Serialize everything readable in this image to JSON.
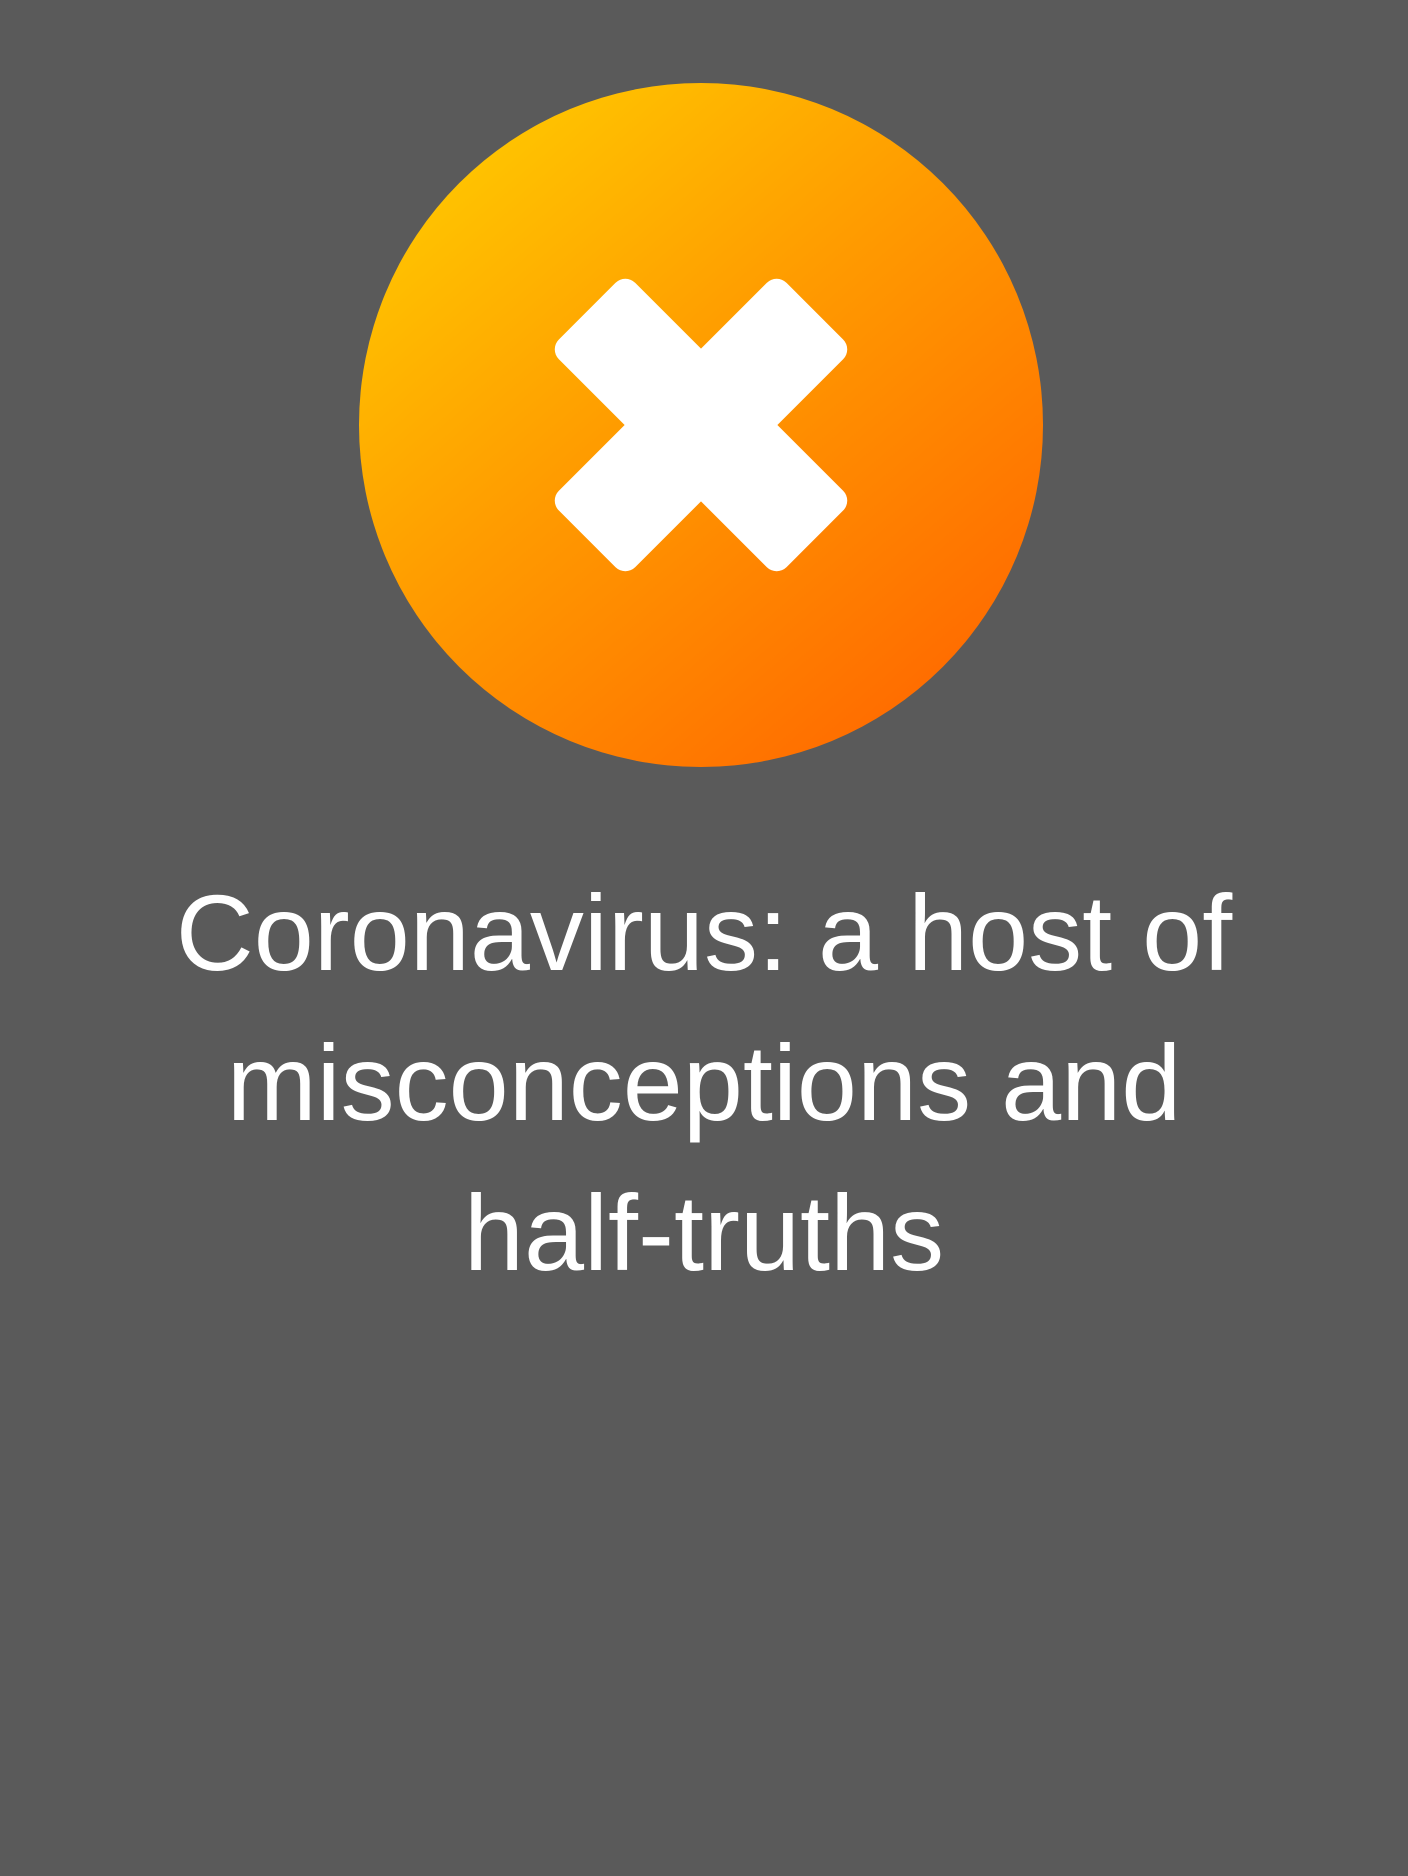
{
  "page": {
    "background_color": "#5a5a5a"
  },
  "badge": {
    "icon": "close-icon",
    "gradient_colors": [
      "#ffc600",
      "#ff9a00",
      "#ff6a00"
    ],
    "mark_color": "#ffffff"
  },
  "headline": {
    "lines": [
      "Coronavirus: a host of",
      "misconceptions and",
      "half-truths"
    ],
    "color": "#ffffff"
  }
}
